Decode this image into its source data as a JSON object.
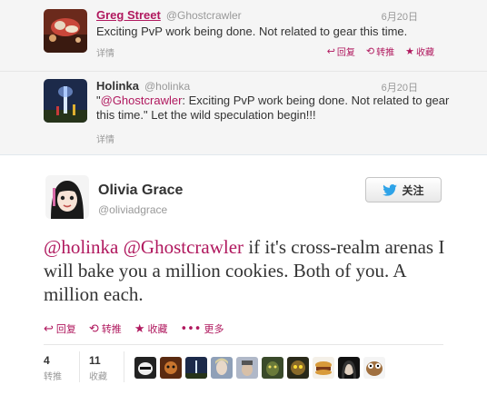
{
  "conversation": {
    "tweets": [
      {
        "name": "Greg Street",
        "handle": "@Ghostcrawler",
        "time": "6月20日",
        "text": "Exciting PvP work being done. Not related to gear this time.",
        "detail": "详情",
        "actions": {
          "reply": "回复",
          "retweet": "转推",
          "favorite": "收藏"
        }
      },
      {
        "name": "Holinka",
        "handle": "@holinka",
        "time": "6月20日",
        "quote_open": "\"",
        "mention": "@Ghostcrawler",
        "text_rest": ": Exciting PvP work being done. Not related to gear this time.\" Let the wild speculation begin!!!",
        "detail": "详情"
      }
    ]
  },
  "main_tweet": {
    "name": "Olivia Grace",
    "handle": "@oliviadgrace",
    "follow_label": "关注",
    "mention1": "@holinka",
    "mention2": "@Ghostcrawler",
    "text_rest": " if it's cross-realm arenas I will bake you a million cookies. Both of you. A million each.",
    "actions": {
      "reply": "回复",
      "retweet": "转推",
      "favorite": "收藏",
      "more": "更多"
    },
    "stats": {
      "retweets_count": "4",
      "retweets_label": "转推",
      "favorites_count": "11",
      "favorites_label": "收藏"
    }
  },
  "colors": {
    "link": "#b0185e",
    "twitter_blue": "#2ea3e8"
  }
}
